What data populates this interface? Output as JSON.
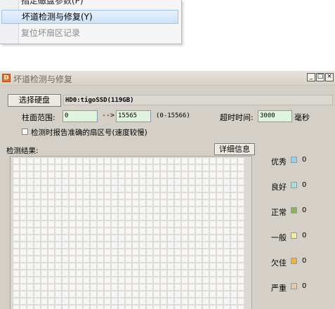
{
  "context_menu": {
    "items": [
      {
        "label": "指定磁盘参数(P)",
        "state": "partial"
      },
      {
        "label": "坏道检测与修复(Y)",
        "state": "hover"
      },
      {
        "label": "复位坏扇区记录",
        "state": "disabled"
      }
    ]
  },
  "window": {
    "title": "坏道检测与修复",
    "app_icon_glyph": "D",
    "controls": {
      "minimize": "_",
      "maximize": "□",
      "close": "×"
    }
  },
  "disk": {
    "select_button": "选择硬盘",
    "info": "HD0:tigoSSD(119GB)"
  },
  "range": {
    "label": "柱面范围:",
    "start": "0",
    "arrow": "-->",
    "end": "15565",
    "hint": "(0-15566)"
  },
  "timeout": {
    "label": "超时时间:",
    "value": "3000",
    "unit": "毫秒"
  },
  "options": {
    "accurate_sector_label": "检测时报告准确的扇区号(速度较慢)",
    "accurate_sector_checked": false
  },
  "results": {
    "label": "检测结果:",
    "details_button": "详细信息",
    "grid_cell_color": "#f7f7f7",
    "grid_bg_color": "#dcd9d4"
  },
  "legend": [
    {
      "label": "优秀",
      "count": "0",
      "color": "#8fd3f0"
    },
    {
      "label": "良好",
      "count": "0",
      "color": "#a7ddd8"
    },
    {
      "label": "正常",
      "count": "0",
      "color": "#8cb25a"
    },
    {
      "label": "一般",
      "count": "0",
      "color": "#f5ea9a"
    },
    {
      "label": "欠佳",
      "count": "0",
      "color": "#f3b13a"
    },
    {
      "label": "严重",
      "count": "0",
      "color": "#e2c6b0"
    }
  ]
}
